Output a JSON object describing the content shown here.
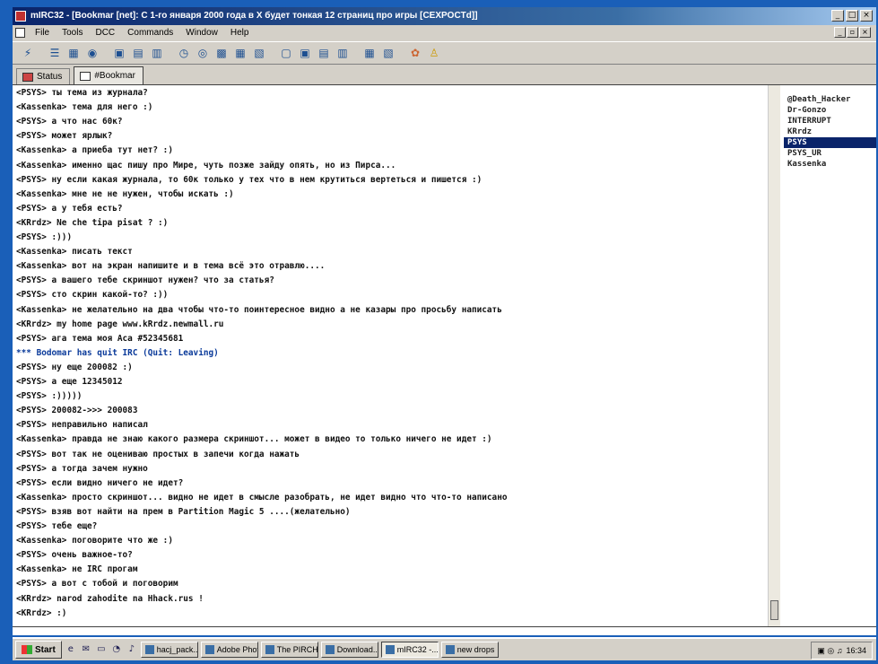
{
  "window": {
    "title": "mIRC32 - [Bookmar [net]: С 1-го января 2000 года в Х будет тонкая 12 страниц про игры [CEXPOCTd]]",
    "minimize_label": "_",
    "maximize_label": "□",
    "close_label": "×"
  },
  "menu": [
    "File",
    "Tools",
    "DCC",
    "Commands",
    "Window",
    "Help"
  ],
  "toolbar_icons": [
    "connect-icon",
    "options-icon",
    "channels-icon",
    "address-book-icon",
    "dcc-send-icon",
    "dcc-chat-icon",
    "scripts-icon",
    "timer-icon",
    "colors-icon",
    "log-icon",
    "notify-icon",
    "urls-icon",
    "ident-icon",
    "finger-icon",
    "tile-icon",
    "cascade-icon",
    "arrange-icon",
    "help-icon",
    "about-icon"
  ],
  "tabs": [
    {
      "label": "Status"
    },
    {
      "label": "#Bookmar"
    }
  ],
  "chat": [
    {
      "text": "<PSYS> ты тема из журнала?"
    },
    {
      "text": "<Kassenka> тема для него :)"
    },
    {
      "text": "<PSYS> а что нас 60к?"
    },
    {
      "text": "<PSYS> может ярлык?"
    },
    {
      "text": "<Kassenka> а приеба тут нет? :)"
    },
    {
      "text": "<Kassenka> именно щас пишу про Мире, чуть позже зайду опять, но из Пирса..."
    },
    {
      "text": "<PSYS> ну если какая журнала, то 60к только у тех что в нем крутиться вертеться и пишется :)"
    },
    {
      "text": "<Kassenka> мне не не нужен, чтобы искать :)"
    },
    {
      "text": "<PSYS> а у тебя есть?"
    },
    {
      "text": "<KRrdz> Ne che tipa pisat ? :)"
    },
    {
      "text": "<PSYS> :)))"
    },
    {
      "text": "<Kassenka> писать текст"
    },
    {
      "text": "<Kassenka> вот на экран напишите и в тема всё это отравлю...."
    },
    {
      "text": "<PSYS> а вашего тебе скриншот нужен? что за статья?"
    },
    {
      "text": "<PSYS> сто скрин какой-то? :))"
    },
    {
      "text": "<Kassenka> не желательно на два чтобы что-то поинтересное видно а не казары про просьбу написать"
    },
    {
      "text": "<KRrdz> my home page www.kRrdz.newmall.ru"
    },
    {
      "text": "<PSYS> ага тема моя Аса #52345681"
    },
    {
      "text": "*** Bodomar has quit IRC (Quit: Leaving)",
      "sys": true
    },
    {
      "text": "<PSYS> ну еще 200082 :)"
    },
    {
      "text": "<PSYS> а еще 12345012"
    },
    {
      "text": "<PSYS> :)))))"
    },
    {
      "text": "<PSYS> 200082->>> 200083"
    },
    {
      "text": "<PSYS> неправильно написал"
    },
    {
      "text": "<Kassenka> правда не знаю какого размера скриншот... может в видео то только ничего не идет :)"
    },
    {
      "text": "<PSYS> вот так не оцениваю простых в запечи когда нажать"
    },
    {
      "text": "<PSYS> а тогда зачем нужно"
    },
    {
      "text": "<PSYS> если видно ничего не идет?"
    },
    {
      "text": "<Kassenka> просто скриншот... видно не идет в смысле разобрать, не идет видно что что-то написано"
    },
    {
      "text": "<PSYS> взяв вот найти на прем в Partition Magic 5 ....(желательно)"
    },
    {
      "text": "<PSYS> тебе еще?"
    },
    {
      "text": "<Kassenka> поговорите что же :)"
    },
    {
      "text": "<PSYS> очень важное-то?"
    },
    {
      "text": "<Kassenka> не IRC прогам"
    },
    {
      "text": "<PSYS> а вот с тобой и поговорим"
    },
    {
      "text": "<KRrdz> narod zahodite na Hhack.rus !"
    },
    {
      "text": "<KRrdz> :)"
    }
  ],
  "nicklist": [
    {
      "nick": "@Death_Hacker"
    },
    {
      "nick": "Dr-Gonzo"
    },
    {
      "nick": "INTERRUPT"
    },
    {
      "nick": "KRrdz"
    },
    {
      "nick": "PSYS",
      "selected": true
    },
    {
      "nick": "PSYS_UR"
    },
    {
      "nick": "Kassenka"
    }
  ],
  "taskbar": {
    "start_label": "Start",
    "quicklaunch_icons": [
      "ie-icon",
      "outlook-icon",
      "desktop-icon",
      "channel-icon",
      "media-icon"
    ],
    "tasks": [
      {
        "label": "hacj_pack..."
      },
      {
        "label": "Adobe Phot..."
      },
      {
        "label": "The PIRCH..."
      },
      {
        "label": "Download..."
      },
      {
        "label": "mIRC32 -...",
        "active": true
      },
      {
        "label": "new drops"
      }
    ],
    "clock": "16:34"
  },
  "colors": {
    "title_bar": "#0a246a",
    "desktop_border": "#1a5fb8",
    "selected_nick": "#0a246a"
  }
}
